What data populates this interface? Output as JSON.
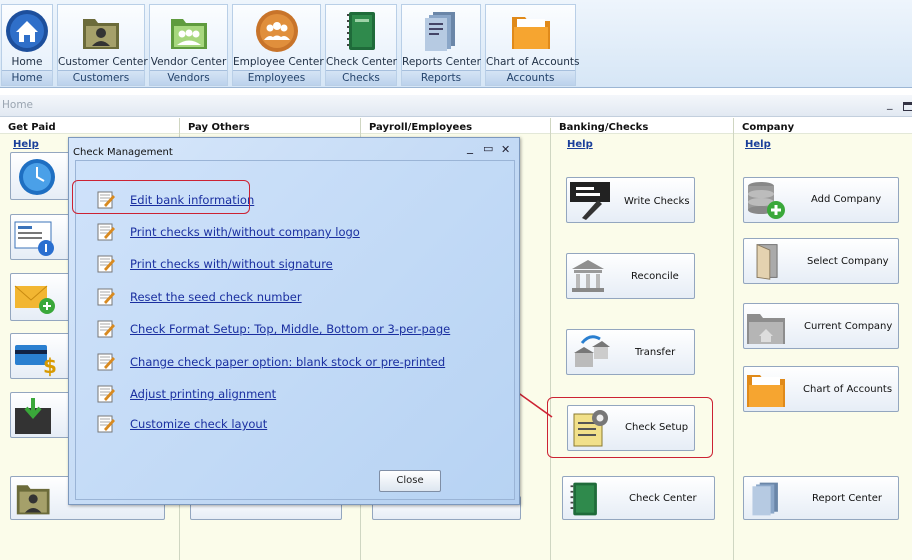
{
  "ribbon": {
    "buttons": [
      {
        "label": "Home",
        "group": "Home",
        "icon": "home-icon"
      },
      {
        "label": "Customer Center",
        "group": "Customers",
        "icon": "customer-folder-icon"
      },
      {
        "label": "Vendor Center",
        "group": "Vendors",
        "icon": "vendor-folder-icon"
      },
      {
        "label": "Employee Center",
        "group": "Employees",
        "icon": "employees-icon"
      },
      {
        "label": "Check Center",
        "group": "Checks",
        "icon": "checkbook-icon"
      },
      {
        "label": "Reports Center",
        "group": "Reports",
        "icon": "reports-icon"
      },
      {
        "label": "Chart of Accounts",
        "group": "Accounts",
        "icon": "accounts-folder-icon"
      }
    ]
  },
  "home_bar": {
    "title": "Home",
    "minimize": "_"
  },
  "columns": [
    {
      "title": "Get Paid",
      "help": "Help"
    },
    {
      "title": "Pay Others",
      "help": ""
    },
    {
      "title": "Payroll/Employees",
      "help": ""
    },
    {
      "title": "Banking/Checks",
      "help": "Help"
    },
    {
      "title": "Company",
      "help": "Help"
    }
  ],
  "banking": {
    "write_checks": "Write Checks",
    "reconcile": "Reconcile",
    "transfer": "Transfer",
    "check_setup": "Check Setup",
    "check_center": "Check Center"
  },
  "company": {
    "add_company": "Add Company",
    "select_company": "Select Company",
    "current_company": "Current Company",
    "chart_of_accounts": "Chart of Accounts",
    "report_center": "Report Center"
  },
  "dialog": {
    "title": "Check Management",
    "controls": {
      "minimize": "_",
      "maximize": "▭",
      "close": "✕"
    },
    "items": [
      "Edit bank information",
      "Print checks with/without company logo",
      "Print checks with/without signature",
      "Reset the seed check number",
      "Check Format Setup: Top, Middle, Bottom or 3-per-page",
      "Change check paper option: blank stock or pre-printed",
      "Adjust printing alignment",
      "Customize check layout"
    ],
    "close_label": "Close"
  },
  "colors": {
    "annotation": "#cc2233",
    "link": "#1a2fa0",
    "column_bg": "#fbfcea"
  }
}
